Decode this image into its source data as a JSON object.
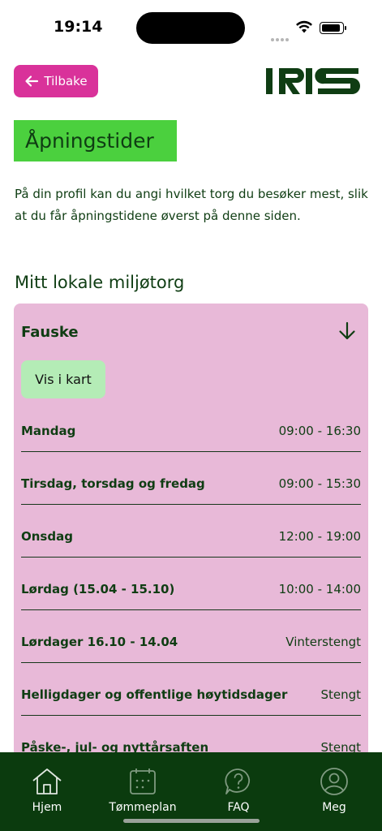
{
  "status": {
    "time": "19:14"
  },
  "header": {
    "back_label": "Tilbake",
    "logo_text": "IRIS"
  },
  "page": {
    "title": "Åpningstider",
    "intro": "På din profil kan du angi hvilket torg du besøker mest, slik at du får åpningstidene øverst på denne siden.",
    "section_title": "Mitt lokale miljøtorg"
  },
  "location": {
    "name": "Fauske",
    "map_button": "Vis i kart",
    "hours": [
      {
        "day": "Mandag",
        "time": "09:00 - 16:30"
      },
      {
        "day": "Tirsdag, torsdag og fredag",
        "time": "09:00 - 15:30"
      },
      {
        "day": "Onsdag",
        "time": "12:00 - 19:00"
      },
      {
        "day": "Lørdag (15.04 - 15.10)",
        "time": "10:00 - 14:00"
      },
      {
        "day": "Lørdager 16.10 - 14.04",
        "time": "Vinterstengt"
      },
      {
        "day": "Helligdager og offentlige høytidsdager",
        "time": "Stengt"
      },
      {
        "day": "Påske-, jul- og nyttårsaften",
        "time": "Stengt"
      }
    ]
  },
  "tabs": [
    {
      "label": "Hjem",
      "icon": "home-icon"
    },
    {
      "label": "Tømmeplan",
      "icon": "calendar-icon"
    },
    {
      "label": "FAQ",
      "icon": "question-icon"
    },
    {
      "label": "Meg",
      "icon": "profile-icon"
    }
  ],
  "colors": {
    "accent_pink": "#d9329a",
    "title_green": "#4bd03e",
    "card_pink": "#e8b9d8",
    "tabbar": "#0b3b0e",
    "map_button": "#b4ecb6"
  }
}
